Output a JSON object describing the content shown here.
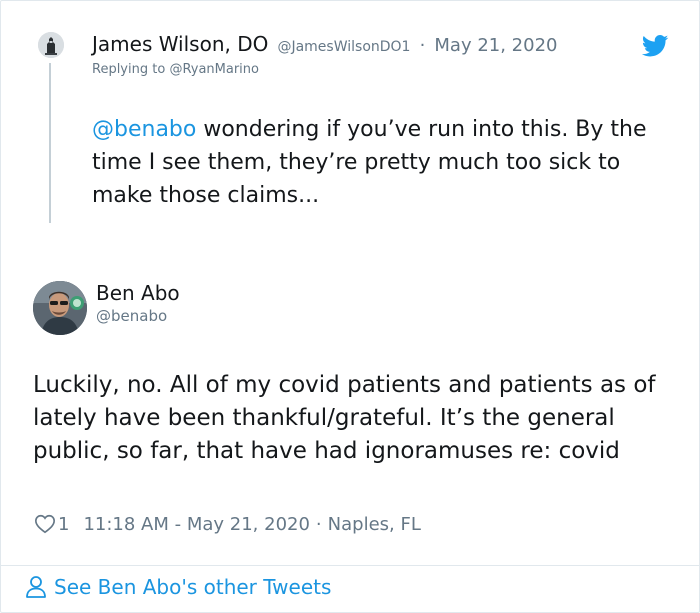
{
  "parent_tweet": {
    "name": "James Wilson, DO",
    "handle": "@JamesWilsonDO1",
    "separator": "·",
    "date": "May 21, 2020",
    "replying_to_prefix": "Replying to",
    "replying_to_handle": "@RyanMarino",
    "mention": "@benabo",
    "text_rest": " wondering if you’ve run into this. By the time I see them, they’re pretty much too sick to make those claims..."
  },
  "tweet": {
    "name": "Ben Abo",
    "handle": "@benabo",
    "text": "Luckily, no. All of my covid patients and patients as of lately have been thankful/grateful. It’s the general public, so far, that have had ignoramuses re: covid",
    "like_count": "1",
    "timestamp": "11:18 AM - May 21, 2020",
    "separator": "·",
    "location": "Naples, FL"
  },
  "footer": {
    "link_label": "See Ben Abo's other Tweets"
  },
  "icons": {
    "brand": "twitter-bird-icon",
    "like": "heart-icon",
    "footer": "person-icon"
  },
  "colors": {
    "accent": "#1b95e0",
    "twitter_blue": "#1da1f2",
    "muted": "#657786",
    "text": "#14171a"
  }
}
